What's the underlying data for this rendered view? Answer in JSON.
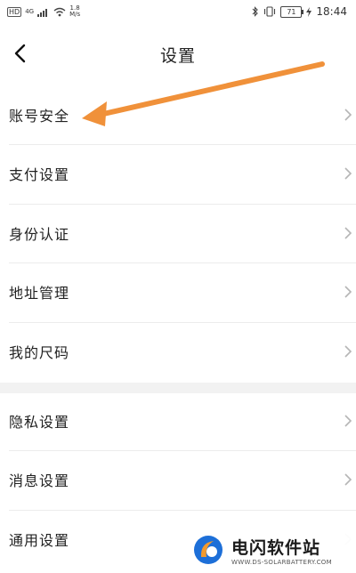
{
  "status_bar": {
    "sim": "HD",
    "network": "4G",
    "speed_value": "1.8",
    "speed_unit": "M/s",
    "battery": "71",
    "time": "18:44"
  },
  "header": {
    "title": "设置"
  },
  "group1": [
    {
      "label": "账号安全"
    },
    {
      "label": "支付设置"
    },
    {
      "label": "身份认证"
    },
    {
      "label": "地址管理"
    },
    {
      "label": "我的尺码"
    }
  ],
  "group2": [
    {
      "label": "隐私设置"
    },
    {
      "label": "消息设置"
    },
    {
      "label": "通用设置"
    }
  ],
  "annotation": {
    "color": "#f0913a"
  },
  "watermark": {
    "brand": "电闪软件站",
    "url": "WWW.DS-SOLARBATTERY.COM"
  }
}
